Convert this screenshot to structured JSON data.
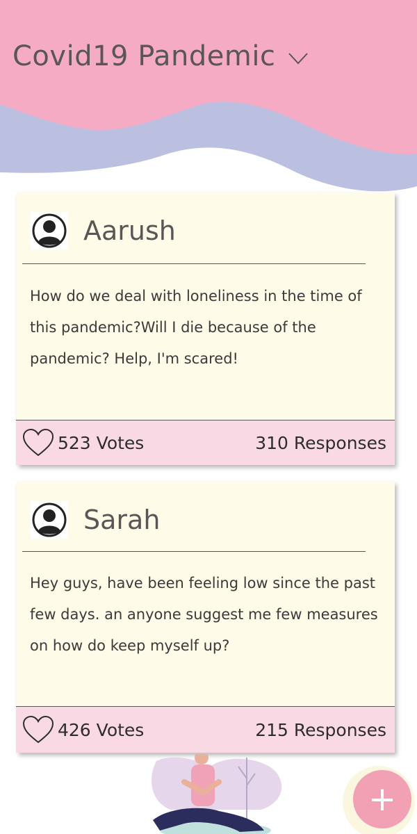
{
  "header": {
    "topic": "Covid19 Pandemic",
    "dropdown_icon": "chevron-down-icon",
    "colors": {
      "pink": "#f5abc4",
      "lavender": "#bbbfe0"
    }
  },
  "posts": [
    {
      "author": "Aarush",
      "text": "How do we deal with loneliness in the time of this pandemic?Will I die because of the pandemic? Help, I'm scared!",
      "votes": "523 Votes",
      "responses": "310 Responses"
    },
    {
      "author": "Sarah",
      "text": "Hey guys, have been feeling low since the past few days. an anyone suggest me few measures on  how do keep myself up?",
      "votes": "426 Votes",
      "responses": "215 Responses"
    }
  ],
  "fab": {
    "label": "+",
    "icon": "plus-icon",
    "color": "#f2a0b4"
  },
  "card_color": "#fefbe8",
  "footer_color": "#f9d9e4"
}
